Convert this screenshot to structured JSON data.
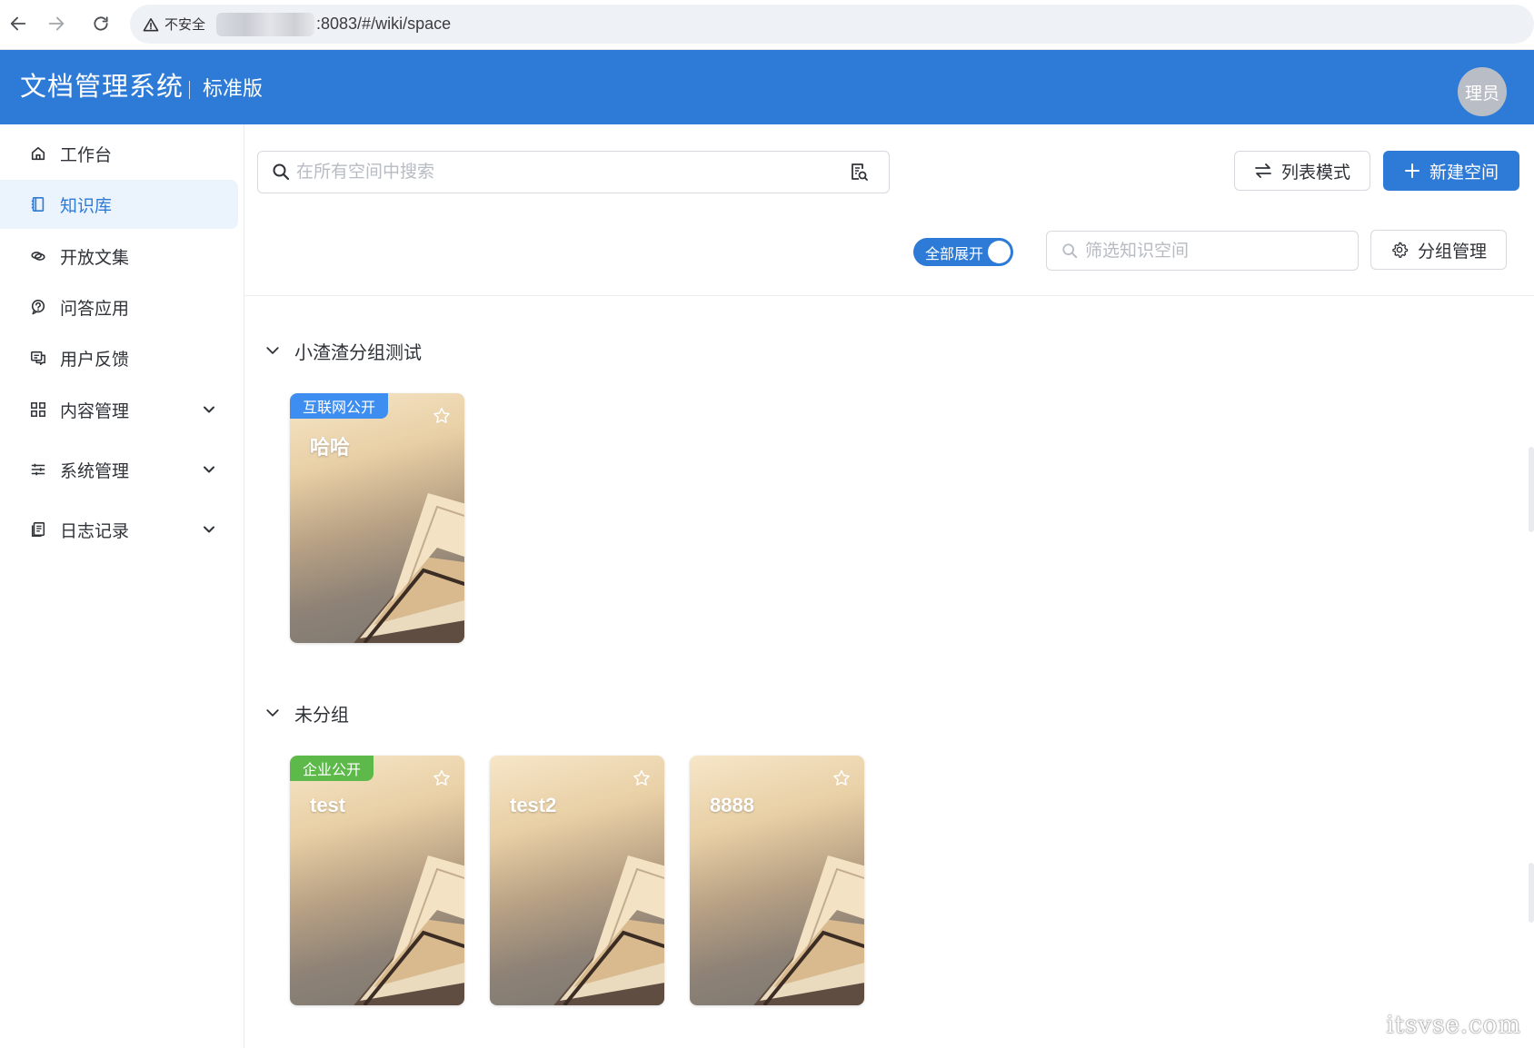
{
  "browser": {
    "security_label": "不安全",
    "url": "​:8083/#/wiki/space"
  },
  "header": {
    "app_title": "文档管理系统",
    "edition": "标准版",
    "avatar_text": "理员"
  },
  "sidebar": {
    "items": [
      {
        "label": "工作台",
        "icon": "home-icon"
      },
      {
        "label": "知识库",
        "icon": "book-icon",
        "active": true
      },
      {
        "label": "开放文集",
        "icon": "link-icon"
      },
      {
        "label": "问答应用",
        "icon": "qa-icon"
      },
      {
        "label": "用户反馈",
        "icon": "feedback-icon"
      },
      {
        "label": "内容管理",
        "icon": "grid-icon",
        "expandable": true
      },
      {
        "label": "系统管理",
        "icon": "sliders-icon",
        "expandable": true
      },
      {
        "label": "日志记录",
        "icon": "log-icon",
        "expandable": true
      }
    ]
  },
  "main": {
    "search_placeholder": "在所有空间中搜索",
    "list_mode_label": "列表模式",
    "new_space_label": "新建空间",
    "expand_all_label": "全部展开",
    "expand_all_on": true,
    "filter_placeholder": "筛选知识空间",
    "group_manage_label": "分组管理",
    "groups": [
      {
        "name": "小渣渣分组测试",
        "cards": [
          {
            "title": "哈哈",
            "badge": "互联网公开",
            "badge_color": "#3d8ef0"
          }
        ]
      },
      {
        "name": "未分组",
        "cards": [
          {
            "title": "test",
            "badge": "企业公开",
            "badge_color": "#5cb94a"
          },
          {
            "title": "test2",
            "badge": ""
          },
          {
            "title": "8888",
            "badge": ""
          }
        ]
      }
    ]
  },
  "watermark": "itsvse.com",
  "colors": {
    "primary": "#2d7bd7",
    "badge_internet": "#3d8ef0",
    "badge_enterprise": "#5cb94a"
  }
}
